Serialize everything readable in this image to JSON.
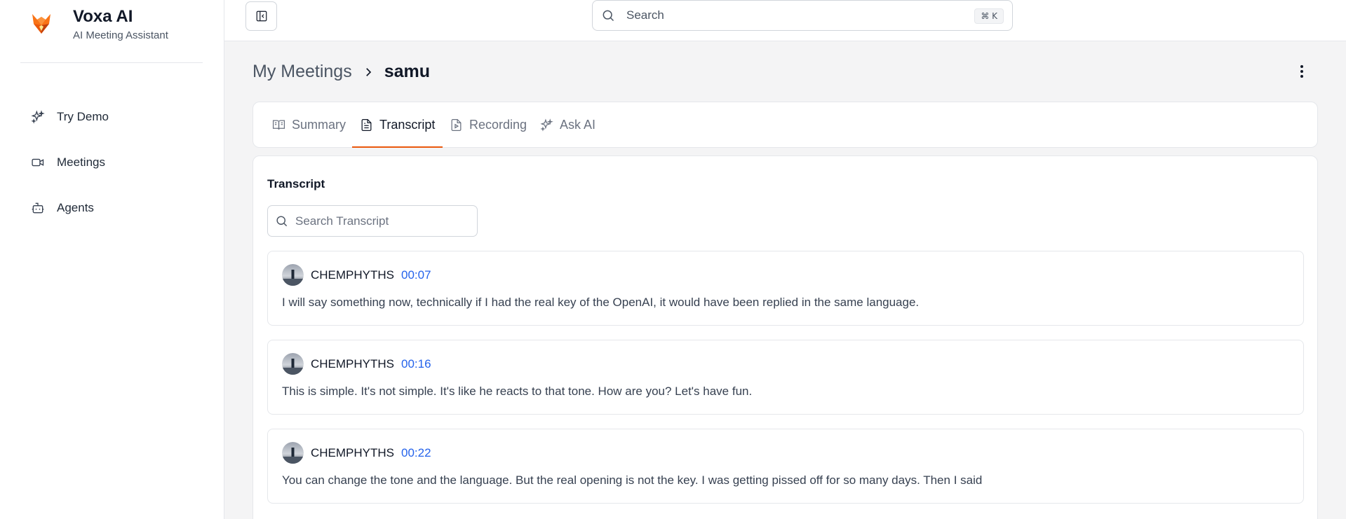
{
  "brand": {
    "title": "Voxa AI",
    "subtitle": "AI Meeting Assistant"
  },
  "sidebar": {
    "items": [
      {
        "label": "Try Demo",
        "icon": "sparkle-icon"
      },
      {
        "label": "Meetings",
        "icon": "video-icon"
      },
      {
        "label": "Agents",
        "icon": "bot-icon"
      }
    ]
  },
  "topbar": {
    "search_placeholder": "Search",
    "shortcut": "⌘ K"
  },
  "header": {
    "breadcrumb_parent": "My Meetings",
    "breadcrumb_current": "samu"
  },
  "tabs": [
    {
      "label": "Summary",
      "icon": "book-open-icon",
      "active": false
    },
    {
      "label": "Transcript",
      "icon": "file-text-icon",
      "active": true
    },
    {
      "label": "Recording",
      "icon": "file-video-icon",
      "active": false
    },
    {
      "label": "Ask AI",
      "icon": "sparkle-icon",
      "active": false
    }
  ],
  "transcript": {
    "title": "Transcript",
    "search_placeholder": "Search Transcript",
    "entries": [
      {
        "speaker": "CHEMPHYTHS",
        "time": "00:07",
        "text": "I will say something now, technically if I had the real key of the OpenAI, it would have been replied in the same language."
      },
      {
        "speaker": "CHEMPHYTHS",
        "time": "00:16",
        "text": "This is simple. It's not simple. It's like he reacts to that tone. How are you? Let's have fun."
      },
      {
        "speaker": "CHEMPHYTHS",
        "time": "00:22",
        "text": "You can change the tone and the language. But the real opening is not the key. I was getting pissed off for so many days. Then I said"
      }
    ]
  },
  "colors": {
    "accent": "#ea580c",
    "timestamp": "#2563eb"
  }
}
